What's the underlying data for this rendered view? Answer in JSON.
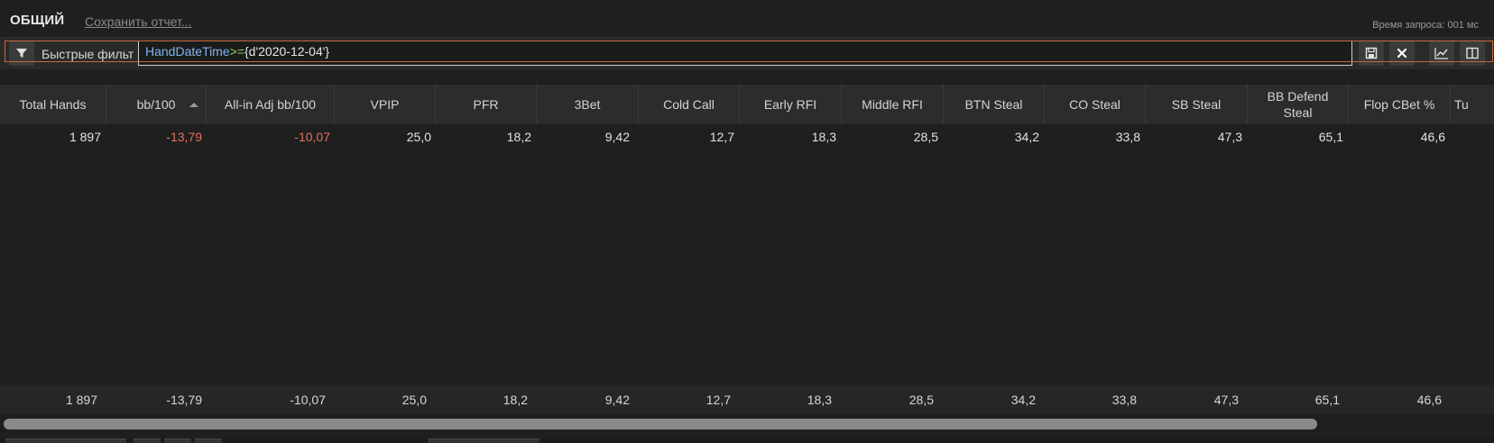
{
  "header": {
    "title": "ОБЩИЙ",
    "save_report_link": "Сохранить отчет...",
    "query_time": "Время запроса: 001 мс"
  },
  "filter": {
    "label": "Быстрые фильт",
    "expression_field": "HandDateTime",
    "expression_operator": ">=",
    "expression_value": "{d'2020-12-04'}",
    "icons": [
      "filter-icon",
      "save-icon",
      "close-icon",
      "chart-icon",
      "layout-icon"
    ]
  },
  "table": {
    "columns": [
      {
        "label": "Total Hands"
      },
      {
        "label": "bb/100",
        "sorted": true
      },
      {
        "label": "All-in Adj bb/100"
      },
      {
        "label": "VPIP"
      },
      {
        "label": "PFR"
      },
      {
        "label": "3Bet"
      },
      {
        "label": "Cold Call"
      },
      {
        "label": "Early RFI"
      },
      {
        "label": "Middle RFI"
      },
      {
        "label": "BTN Steal"
      },
      {
        "label": "CO Steal"
      },
      {
        "label": "SB Steal"
      },
      {
        "label": "BB Defend Steal"
      },
      {
        "label": "Flop CBet %"
      },
      {
        "label": "Tu"
      }
    ],
    "row": [
      "1 897",
      "-13,79",
      "-10,07",
      "25,0",
      "18,2",
      "9,42",
      "12,7",
      "18,3",
      "28,5",
      "34,2",
      "33,8",
      "47,3",
      "65,1",
      "46,6"
    ],
    "totals": [
      "1 897",
      "-13,79",
      "-10,07",
      "25,0",
      "18,2",
      "9,42",
      "12,7",
      "18,3",
      "28,5",
      "34,2",
      "33,8",
      "47,3",
      "65,1",
      "46,6"
    ]
  },
  "colors": {
    "negative": "#e0705d",
    "selection_border": "#c7673a",
    "filter_field": "#7eb6ee",
    "filter_operator": "#8fd06b"
  }
}
